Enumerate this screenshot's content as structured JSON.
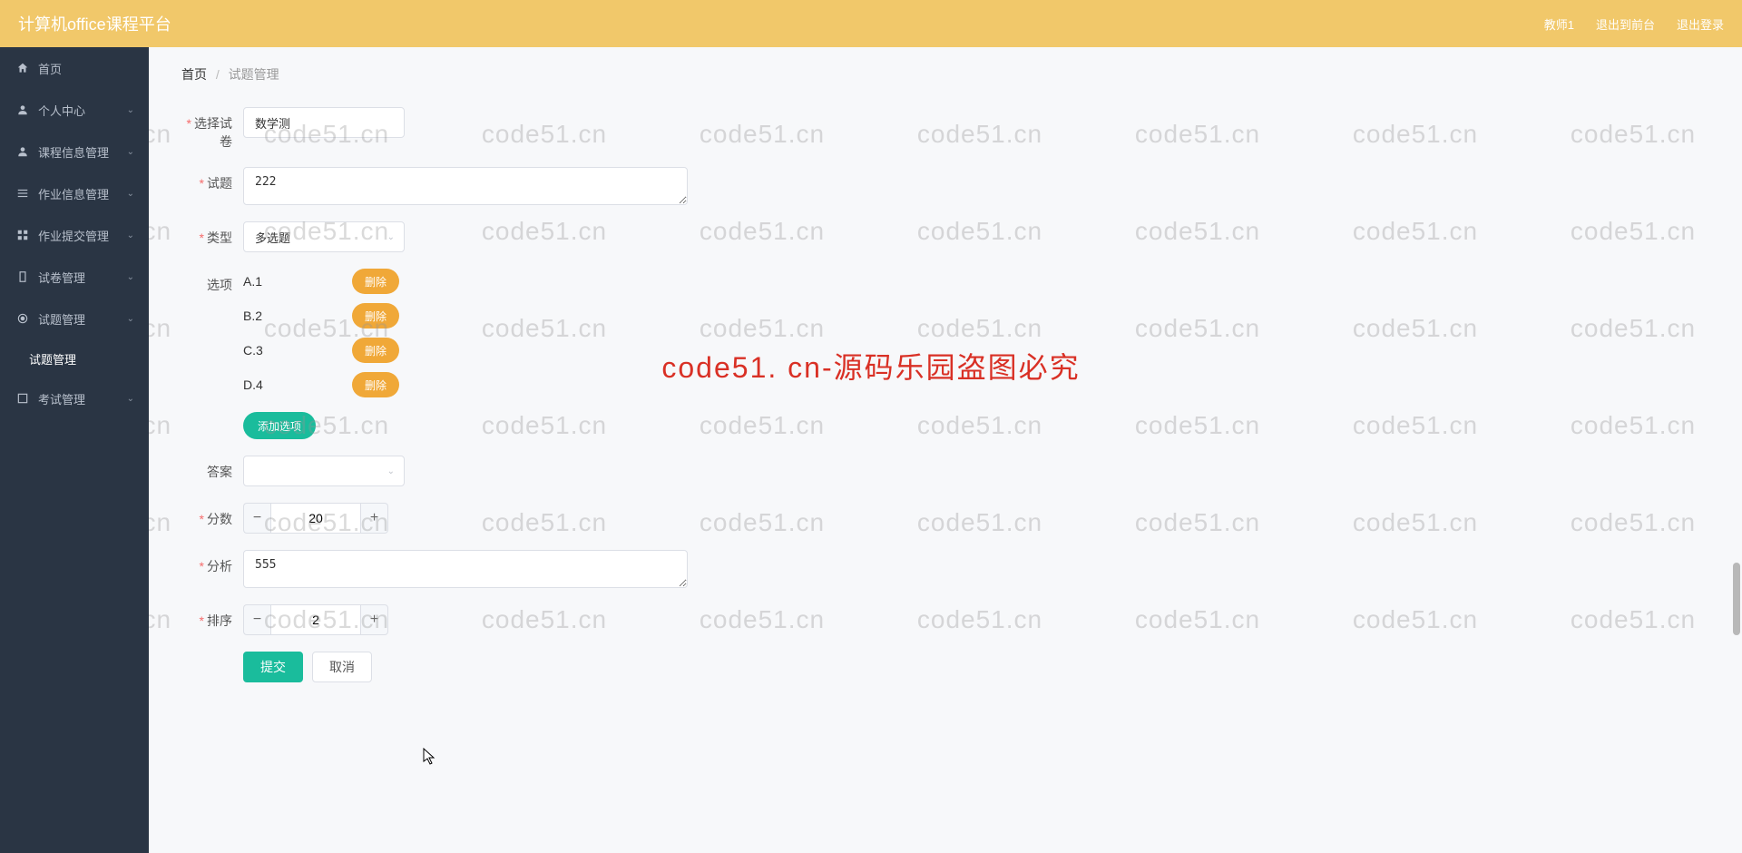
{
  "header": {
    "logo": "计算机office课程平台",
    "user": "教师1",
    "exit_to_front": "退出到前台",
    "logout": "退出登录"
  },
  "sidebar": {
    "items": [
      {
        "icon": "home",
        "label": "首页",
        "expandable": false
      },
      {
        "icon": "user",
        "label": "个人中心",
        "expandable": true
      },
      {
        "icon": "user-mg",
        "label": "课程信息管理",
        "expandable": true
      },
      {
        "icon": "list",
        "label": "作业信息管理",
        "expandable": true
      },
      {
        "icon": "grid",
        "label": "作业提交管理",
        "expandable": true
      },
      {
        "icon": "paper",
        "label": "试卷管理",
        "expandable": true
      },
      {
        "icon": "target",
        "label": "试题管理",
        "expandable": true
      },
      {
        "icon": "",
        "label": "试题管理",
        "expandable": false,
        "sub": true,
        "active": true
      },
      {
        "icon": "exam",
        "label": "考试管理",
        "expandable": true
      }
    ]
  },
  "breadcrumb": {
    "home": "首页",
    "current": "试题管理"
  },
  "form": {
    "select_paper": {
      "label": "选择试卷",
      "value": "数学测"
    },
    "question": {
      "label": "试题",
      "value": "222"
    },
    "type": {
      "label": "类型",
      "value": "多选题"
    },
    "options": {
      "label": "选项",
      "items": [
        "A.1",
        "B.2",
        "C.3",
        "D.4"
      ],
      "delete_btn": "删除",
      "add_btn": "添加选项"
    },
    "answer": {
      "label": "答案",
      "value": ""
    },
    "score": {
      "label": "分数",
      "value": "20"
    },
    "analysis": {
      "label": "分析",
      "value": "555"
    },
    "sort": {
      "label": "排序",
      "value": "2"
    },
    "submit": "提交",
    "cancel": "取消"
  },
  "watermark": {
    "text": "code51.cn",
    "center": "code51. cn-源码乐园盗图必究"
  }
}
